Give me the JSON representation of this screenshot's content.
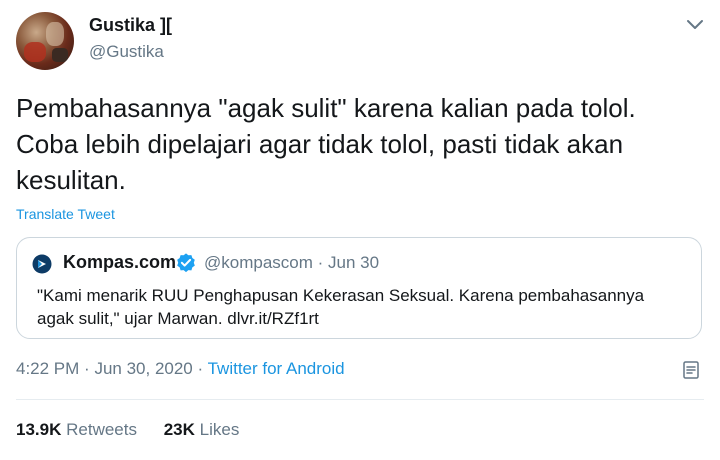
{
  "tweet": {
    "author": {
      "display_name": "Gustika ][",
      "handle": "@Gustika"
    },
    "text_lines": [
      "Pembahasannya \"agak sulit\" karena kalian pada tolol.",
      "Coba lebih dipelajari agar tidak tolol, pasti tidak akan",
      "kesulitan."
    ],
    "translate_label": "Translate Tweet",
    "quoted": {
      "name": "Kompas.com",
      "handle": "@kompascom",
      "separator": "·",
      "date": "Jun 30",
      "text_lines": [
        "\"Kami menarik RUU Penghapusan Kekerasan Seksual. Karena pembahasannya",
        "agak sulit,\" ujar Marwan. dlvr.it/RZf1rt"
      ],
      "verified_color": "#1da1f2"
    },
    "meta": {
      "time": "4:22 PM",
      "date": "Jun 30, 2020",
      "separator": "·",
      "source": "Twitter for Android"
    },
    "stats": {
      "retweets_count": "13.9K",
      "retweets_label": "Retweets",
      "likes_count": "23K",
      "likes_label": "Likes"
    },
    "icons": [
      "chevron-down-icon",
      "kompas-logo-icon",
      "verified-icon",
      "analytics-icon"
    ],
    "colors": {
      "link": "#1b95e0",
      "muted": "#657786",
      "text": "#14171a",
      "border": "#ccd6dd"
    }
  }
}
